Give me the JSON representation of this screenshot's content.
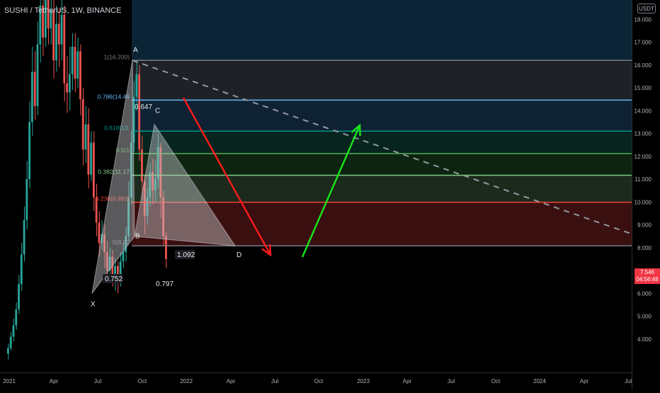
{
  "header": {
    "symbol": "SUSHI / TetherUS, 1W, BINANCE",
    "currency": "USDT"
  },
  "price_badge": {
    "price": "7.546",
    "countdown": "04:56:48",
    "color": "#f23645"
  },
  "chart_data": {
    "type": "candlestick",
    "x_ticks": [
      "2021",
      "Apr",
      "Jul",
      "Oct",
      "2022",
      "Apr",
      "Jul",
      "Oct",
      "2023",
      "Apr",
      "Jul",
      "Oct",
      "2024",
      "Apr",
      "Jul"
    ],
    "y_ticks": [
      "4.000",
      "5.000",
      "6.000",
      "7.000",
      "8.000",
      "9.000",
      "10.000",
      "11.000",
      "12.000",
      "13.000",
      "14.000",
      "15.000",
      "16.000",
      "17.000",
      "18.000"
    ],
    "ylim": [
      3.1,
      19.2
    ],
    "up_color": "#26a69a",
    "down_color": "#ef5350",
    "fib_levels": [
      {
        "ratio": "1",
        "price": 16.2,
        "label": "1(16.200)",
        "color": "#787b86",
        "fill": "#1e2126"
      },
      {
        "ratio": "0.786",
        "price": 14.46,
        "label": "0.786(14.46",
        "color": "#64b5f6",
        "fill": "#0e2233"
      },
      {
        "ratio": "0.618",
        "price": 13.1,
        "label": "0.618(13.",
        "color": "#009688",
        "fill": "#07241f"
      },
      {
        "ratio": "0.5",
        "price": 12.12,
        "label": "0.5(1",
        "color": "#4caf50",
        "fill": "#0c2410"
      },
      {
        "ratio": "0.382",
        "price": 11.17,
        "label": "0.382(11.17",
        "color": "#81c784",
        "fill": "#1b2a1c"
      },
      {
        "ratio": "0.236",
        "price": 9.99,
        "label": "0.236(9.992)",
        "color": "#f44336",
        "fill": "#3a0f10"
      },
      {
        "ratio": "0",
        "price": 8.08,
        "label": "0(8.07",
        "color": "#787b86",
        "fill": null
      }
    ],
    "pattern_points": [
      {
        "label": "X",
        "price": 6.0
      },
      {
        "label": "A",
        "price": 16.2
      },
      {
        "label": "B",
        "price": 8.5
      },
      {
        "label": "C",
        "price": 13.4
      },
      {
        "label": "D",
        "price": 8.08
      }
    ],
    "ratios": [
      "0.647",
      "0.752",
      "0.797",
      "1.092"
    ],
    "trendline_color": "#9598a1",
    "arrows": [
      {
        "direction": "down",
        "color": "#ff1a1a"
      },
      {
        "direction": "up",
        "color": "#19e619"
      }
    ]
  }
}
